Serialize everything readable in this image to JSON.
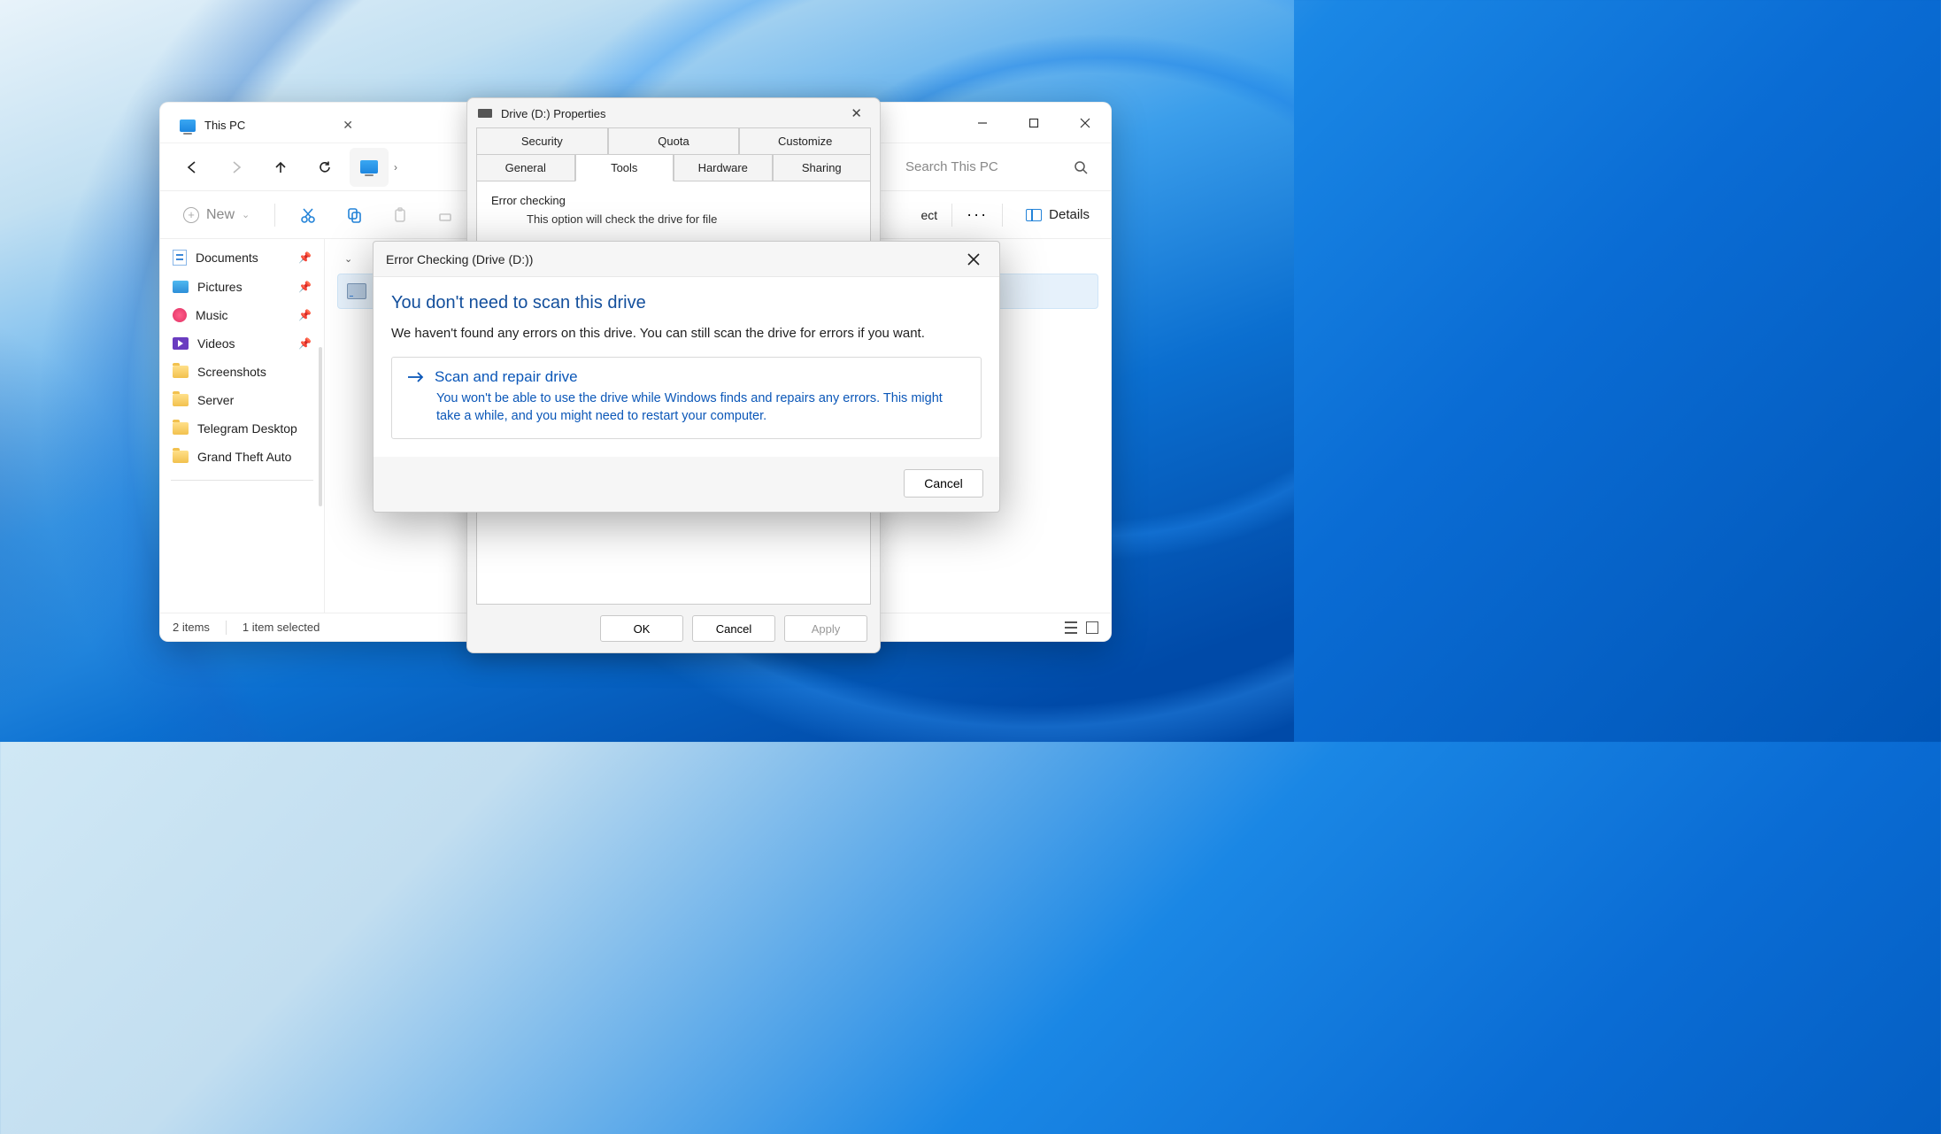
{
  "explorer": {
    "tab_title": "This PC",
    "search_placeholder": "Search This PC",
    "new_label": "New",
    "eject_label": "ect",
    "more_label": "···",
    "details_label": "Details",
    "sidebar": [
      {
        "label": "Documents",
        "icon": "doc",
        "pinned": true
      },
      {
        "label": "Pictures",
        "icon": "pic",
        "pinned": true
      },
      {
        "label": "Music",
        "icon": "music",
        "pinned": true
      },
      {
        "label": "Videos",
        "icon": "video",
        "pinned": true
      },
      {
        "label": "Screenshots",
        "icon": "folder",
        "pinned": false
      },
      {
        "label": "Server",
        "icon": "folder",
        "pinned": false
      },
      {
        "label": "Telegram Desktop",
        "icon": "folder",
        "pinned": false
      },
      {
        "label": "Grand Theft Auto",
        "icon": "folder",
        "pinned": false
      }
    ],
    "status_left": "2 items",
    "status_right": "1 item selected"
  },
  "properties": {
    "title": "Drive (D:) Properties",
    "tabs_row1": [
      "Security",
      "Quota",
      "Customize"
    ],
    "tabs_row2": [
      "General",
      "Tools",
      "Hardware",
      "Sharing"
    ],
    "active_tab": "Tools",
    "section_title": "Error checking",
    "section_desc": "This option will check the drive for file",
    "ok": "OK",
    "cancel": "Cancel",
    "apply": "Apply"
  },
  "error_dialog": {
    "title": "Error Checking (Drive (D:))",
    "heading": "You don't need to scan this drive",
    "message": "We haven't found any errors on this drive. You can still scan the drive for errors if you want.",
    "option_title": "Scan and repair drive",
    "option_desc": "You won't be able to use the drive while Windows finds and repairs any errors. This might take a while, and you might need to restart your computer.",
    "cancel": "Cancel"
  }
}
